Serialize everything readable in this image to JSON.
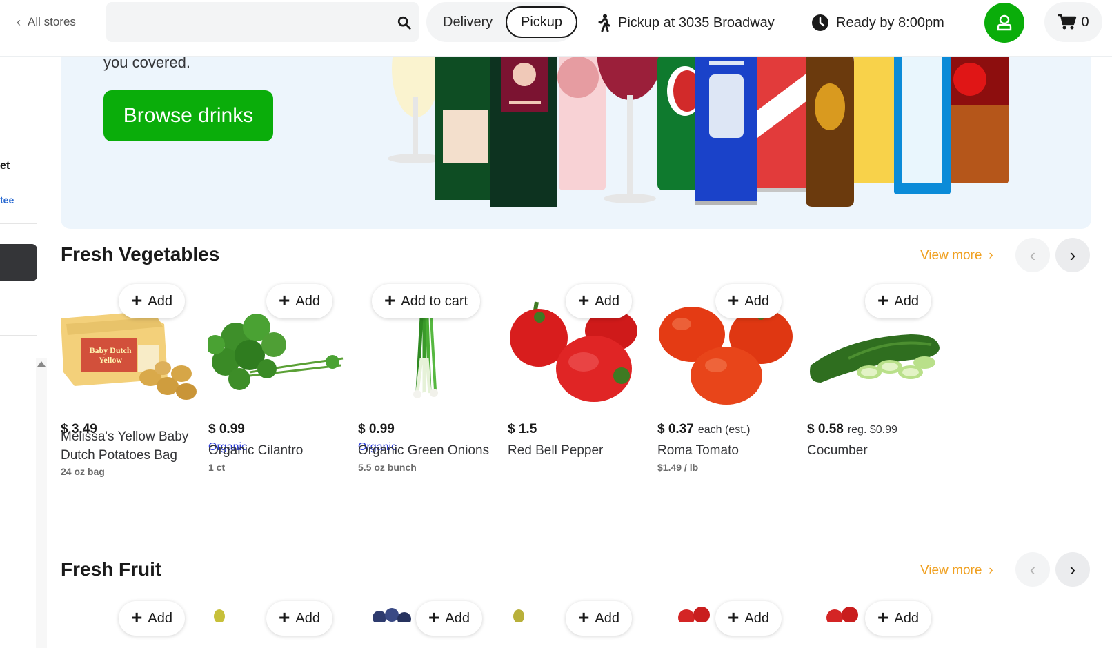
{
  "header": {
    "back_label": "All stores",
    "search": {
      "value": "",
      "placeholder": ""
    },
    "modes": {
      "delivery": "Delivery",
      "pickup": "Pickup",
      "selected": "Pickup"
    },
    "pickup_location": "Pickup at 3035 Broadway",
    "ready_by": "Ready by 8:00pm",
    "cart_count": "0"
  },
  "sidebar": {
    "text1": "et",
    "text2": "tee"
  },
  "banner": {
    "text": "you covered.",
    "button_label": "Browse drinks"
  },
  "sections": {
    "vegetables": {
      "title": "Fresh Vegetables",
      "view_more": "View more"
    },
    "fruit": {
      "title": "Fresh Fruit",
      "view_more": "View more"
    }
  },
  "products": [
    {
      "add_label": "Add",
      "price": "$ 3.49",
      "price_note": "",
      "organic": "",
      "name": "Melissa's Yellow Baby Dutch Potatoes Bag",
      "size": "24 oz bag"
    },
    {
      "add_label": "Add",
      "price": "$ 0.99",
      "price_note": "",
      "organic": "Organic",
      "name": "Organic Cilantro",
      "size": "1 ct"
    },
    {
      "add_label": "Add to cart",
      "price": "$ 0.99",
      "price_note": "",
      "organic": "Organic",
      "name": "Organic Green Onions",
      "size": "5.5 oz bunch"
    },
    {
      "add_label": "Add",
      "price": "$ 1.5",
      "price_note": "",
      "organic": "",
      "name": "Red Bell Pepper",
      "size": ""
    },
    {
      "add_label": "Add",
      "price": "$ 0.37",
      "price_note": "each (est.)",
      "organic": "",
      "name": "Roma Tomato",
      "size": "$1.49 / lb"
    },
    {
      "add_label": "Add",
      "price": "$ 0.58",
      "price_note": "reg. $0.99",
      "organic": "",
      "name": "Cocumber",
      "size": ""
    }
  ],
  "fruit_add_labels": [
    "Add",
    "Add",
    "Add",
    "Add",
    "Add",
    "Add"
  ],
  "colors": {
    "brand_green": "#0aad0a",
    "view_more_orange": "#f0a020",
    "organic_blue": "#2b3dd8",
    "banner_bg": "#edf5fc"
  },
  "icons": {
    "back": "chevron-left-icon",
    "search": "search-icon",
    "pickup": "walking-person-icon",
    "ready": "clock-icon",
    "account": "user-icon",
    "cart": "cart-icon"
  }
}
